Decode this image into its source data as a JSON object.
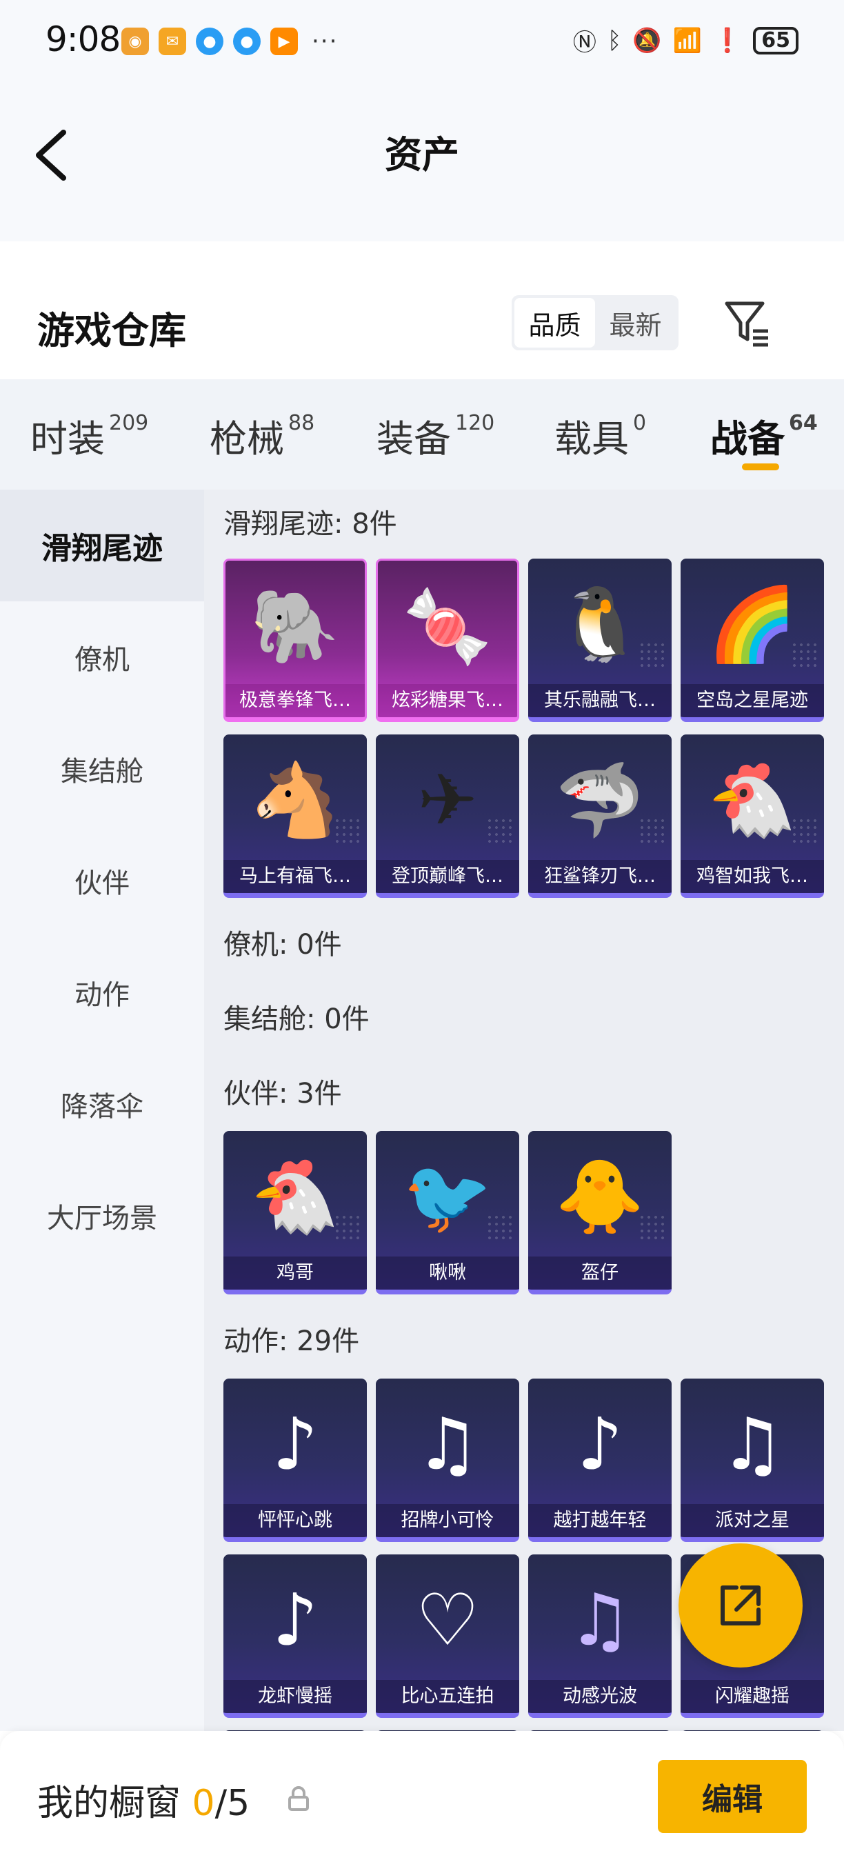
{
  "status_bar": {
    "time": "9:08",
    "battery": "65",
    "apps": [
      {
        "icon": "app-icon-orange",
        "color": "#f0a030"
      },
      {
        "icon": "mail-icon",
        "color": "#f5a623"
      },
      {
        "icon": "app-icon-blue",
        "color": "#2a9df4"
      },
      {
        "icon": "app-icon-blue-2",
        "color": "#2a9df4"
      },
      {
        "icon": "play-icon",
        "color": "#ff8a00"
      }
    ],
    "more": "···"
  },
  "header": {
    "title": "资产"
  },
  "warehouse": {
    "title": "游戏仓库",
    "sort_quality": "品质",
    "sort_newest": "最新"
  },
  "tabs": [
    {
      "label": "时装",
      "count": "209"
    },
    {
      "label": "枪械",
      "count": "88"
    },
    {
      "label": "装备",
      "count": "120"
    },
    {
      "label": "载具",
      "count": "0"
    },
    {
      "label": "战备",
      "count": "64"
    }
  ],
  "active_tab_index": 4,
  "sidebar": {
    "items": [
      "滑翔尾迹",
      "僚机",
      "集结舱",
      "伙伴",
      "动作",
      "降落伞",
      "大厅场景"
    ],
    "active_index": 0
  },
  "sections": {
    "glide": {
      "title": "滑翔尾迹: 8件",
      "items": [
        {
          "label": "极意拳锋飞…",
          "icon": "elephant-icon"
        },
        {
          "label": "炫彩糖果飞…",
          "icon": "candy-icon"
        },
        {
          "label": "其乐融融飞…",
          "icon": "penguin-icon"
        },
        {
          "label": "空岛之星尾迹",
          "icon": "rainbow-trail-icon"
        },
        {
          "label": "马上有福飞…",
          "icon": "horse-icon"
        },
        {
          "label": "登顶巅峰飞…",
          "icon": "jet-icon"
        },
        {
          "label": "狂鲨锋刃飞…",
          "icon": "shark-icon"
        },
        {
          "label": "鸡智如我飞…",
          "icon": "chicken-icon"
        }
      ]
    },
    "wingman": {
      "title": "僚机: 0件"
    },
    "capsule": {
      "title": "集结舱: 0件"
    },
    "partner": {
      "title": "伙伴: 3件",
      "items": [
        {
          "label": "鸡哥",
          "icon": "chicken-icon"
        },
        {
          "label": "啾啾",
          "icon": "bird-icon"
        },
        {
          "label": "盔仔",
          "icon": "helmet-chick-icon"
        }
      ]
    },
    "emote": {
      "title": "动作: 29件",
      "items": [
        {
          "label": "怦怦心跳",
          "icon": "dance-icon"
        },
        {
          "label": "招牌小可怜",
          "icon": "dance-sign-icon"
        },
        {
          "label": "越打越年轻",
          "icon": "dance-icon"
        },
        {
          "label": "派对之星",
          "icon": "dance-icon"
        },
        {
          "label": "龙虾慢摇",
          "icon": "dance-icon"
        },
        {
          "label": "比心五连拍",
          "icon": "heart-pose-icon"
        },
        {
          "label": "动感光波",
          "icon": "dance-glow-icon"
        },
        {
          "label": "闪耀趣摇",
          "icon": "dance-icon"
        },
        {
          "label": "",
          "icon": "dance-icon"
        },
        {
          "label": "",
          "icon": "dance-icon"
        },
        {
          "label": "",
          "icon": "dance-icon"
        },
        {
          "label": "",
          "icon": "dance-icon"
        }
      ]
    }
  },
  "showcase": {
    "title": "我的橱窗",
    "current": "0",
    "total": "/5",
    "edit_label": "编辑"
  },
  "colors": {
    "accent": "#f7b400",
    "card_blue": "#2e2f64",
    "card_pink": "#8a2c92"
  }
}
